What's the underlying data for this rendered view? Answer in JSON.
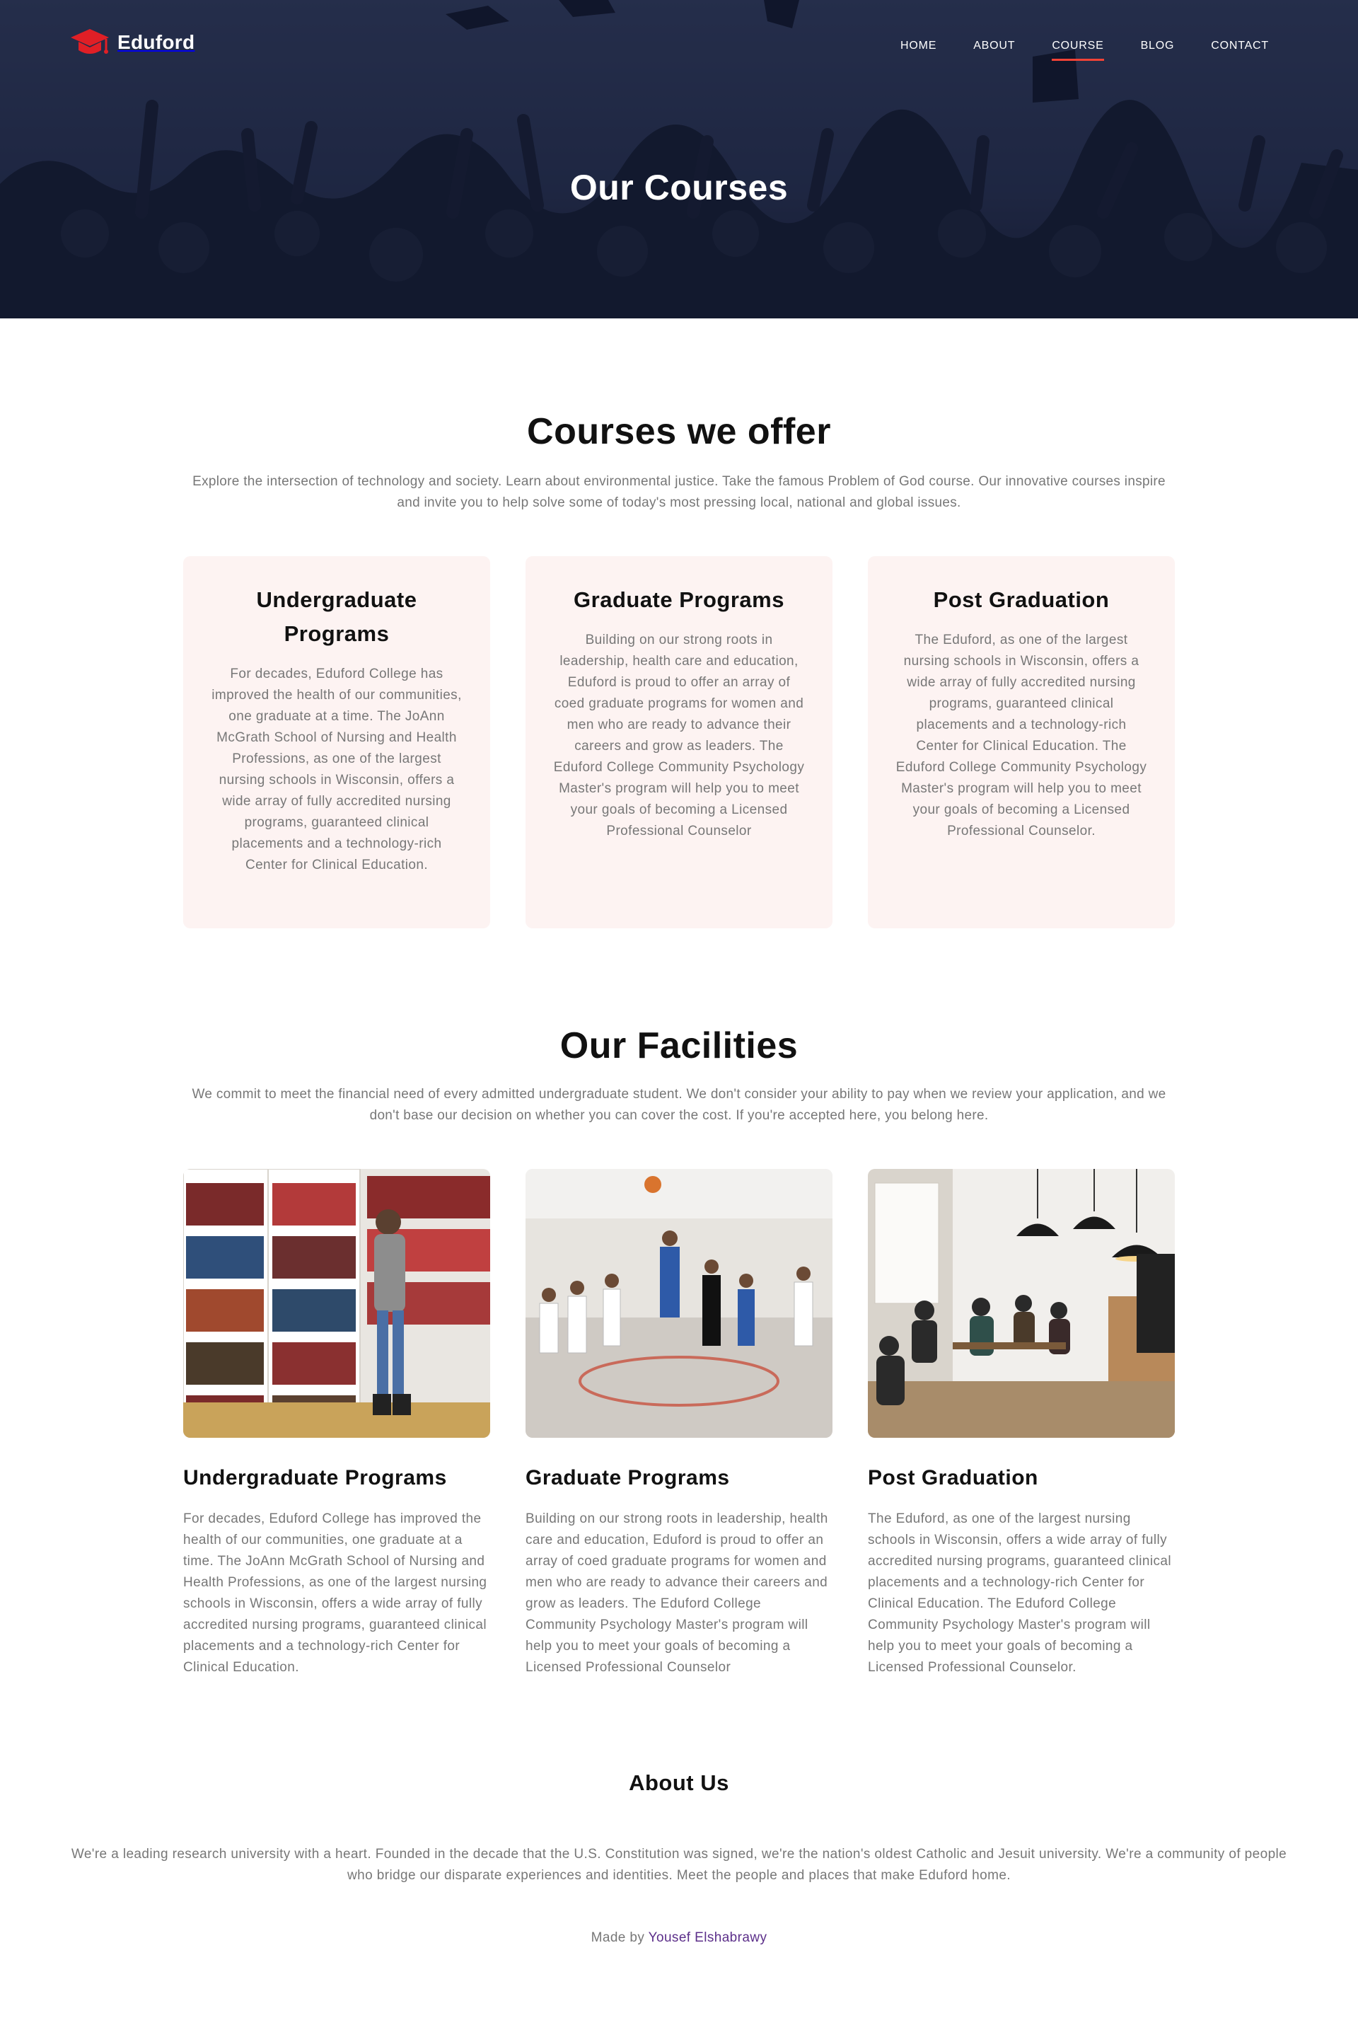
{
  "brand": {
    "name": "Eduford",
    "logo_icon": "graduation-cap-icon",
    "accent_color": "#f44336"
  },
  "nav": {
    "items": [
      {
        "label": "HOME",
        "active": false
      },
      {
        "label": "ABOUT",
        "active": false
      },
      {
        "label": "COURSE",
        "active": true
      },
      {
        "label": "BLOG",
        "active": false
      },
      {
        "label": "CONTACT",
        "active": false
      }
    ]
  },
  "hero": {
    "title": "Our Courses"
  },
  "courses": {
    "title": "Courses we offer",
    "subtitle": "Explore the intersection of technology and society. Learn about environmental justice. Take the famous Problem of God course. Our innovative courses inspire and invite you to help solve some of today's most pressing local, national and global issues.",
    "cards": [
      {
        "title": "Undergraduate Programs",
        "text": "For decades, Eduford College has improved the health of our communities, one graduate at a time. The JoAnn McGrath School of Nursing and Health Professions, as one of the largest nursing schools in Wisconsin, offers a wide array of fully accredited nursing programs, guaranteed clinical placements and a technology-rich Center for Clinical Education."
      },
      {
        "title": "Graduate Programs",
        "text": "Building on our strong roots in leadership, health care and education, Eduford is proud to offer an array of coed graduate programs for women and men who are ready to advance their careers and grow as leaders. The Eduford College Community Psychology Master's program will help you to meet your goals of becoming a Licensed Professional Counselor"
      },
      {
        "title": "Post Graduation",
        "text": "The Eduford, as one of the largest nursing schools in Wisconsin, offers a wide array of fully accredited nursing programs, guaranteed clinical placements and a technology-rich Center for Clinical Education. The Eduford College Community Psychology Master's program will help you to meet your goals of becoming a Licensed Professional Counselor."
      }
    ]
  },
  "facilities": {
    "title": "Our Facilities",
    "subtitle": "We commit to meet the financial need of every admitted undergraduate student. We don't consider your ability to pay when we review your application, and we don't base our decision on whether you can cover the cost. If you're accepted here, you belong here.",
    "cards": [
      {
        "image": "library-photo",
        "title": "Undergraduate Programs",
        "text": "For decades, Eduford College has improved the health of our communities, one graduate at a time. The JoAnn McGrath School of Nursing and Health Professions, as one of the largest nursing schools in Wisconsin, offers a wide array of fully accredited nursing programs, guaranteed clinical placements and a technology-rich Center for Clinical Education."
      },
      {
        "image": "basketball-photo",
        "title": "Graduate Programs",
        "text": "Building on our strong roots in leadership, health care and education, Eduford is proud to offer an array of coed graduate programs for women and men who are ready to advance their careers and grow as leaders. The Eduford College Community Psychology Master's program will help you to meet your goals of becoming a Licensed Professional Counselor"
      },
      {
        "image": "cafeteria-photo",
        "title": "Post Graduation",
        "text": "The Eduford, as one of the largest nursing schools in Wisconsin, offers a wide array of fully accredited nursing programs, guaranteed clinical placements and a technology-rich Center for Clinical Education. The Eduford College Community Psychology Master's program will help you to meet your goals of becoming a Licensed Professional Counselor."
      }
    ]
  },
  "about": {
    "title": "About Us",
    "text": "We're a leading research university with a heart. Founded in the decade that the U.S. Constitution was signed, we're the nation's oldest Catholic and Jesuit university. We're a community of people who bridge our disparate experiences and identities. Meet the people and places that make Eduford home."
  },
  "footer": {
    "prefix": "Made by",
    "author": "Yousef Elshabrawy",
    "link_color": "#5c2f8a"
  }
}
